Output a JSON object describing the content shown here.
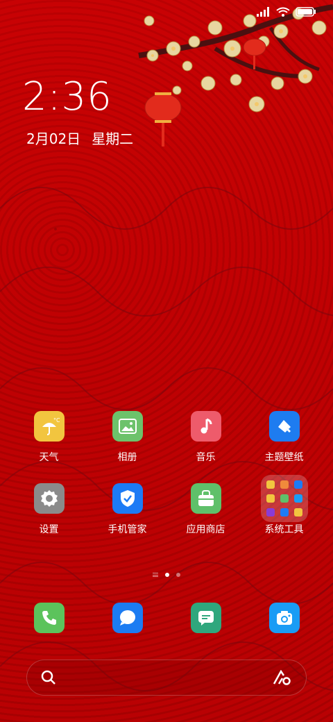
{
  "clock": {
    "time": "2:36",
    "date": "2月02日",
    "weekday": "星期二"
  },
  "status": {
    "icons": [
      "signal-icon",
      "wifi-icon",
      "battery-icon"
    ]
  },
  "apps_row1": [
    {
      "label": "天气",
      "icon": "weather-icon",
      "color": "#f2c53f"
    },
    {
      "label": "相册",
      "icon": "gallery-icon",
      "color": "#6dc26b"
    },
    {
      "label": "音乐",
      "icon": "music-icon",
      "color": "#ee5b6b"
    },
    {
      "label": "主题壁纸",
      "icon": "theme-icon",
      "color": "#1e7cf0"
    }
  ],
  "apps_row2": [
    {
      "label": "设置",
      "icon": "settings-icon",
      "color": "#8b8b8b"
    },
    {
      "label": "手机管家",
      "icon": "security-icon",
      "color": "#1d7bf5"
    },
    {
      "label": "应用商店",
      "icon": "store-icon",
      "color": "#5fc06a"
    },
    {
      "label": "系统工具",
      "icon": "folder-icon",
      "color": "#ffffff"
    }
  ],
  "dock": [
    {
      "icon": "phone-icon",
      "color": "#5cc35c"
    },
    {
      "icon": "message-icon",
      "color": "#1c7cf2"
    },
    {
      "icon": "notes-icon",
      "color": "#2fa77d"
    },
    {
      "icon": "camera-icon",
      "color": "#1a9cf5"
    }
  ]
}
